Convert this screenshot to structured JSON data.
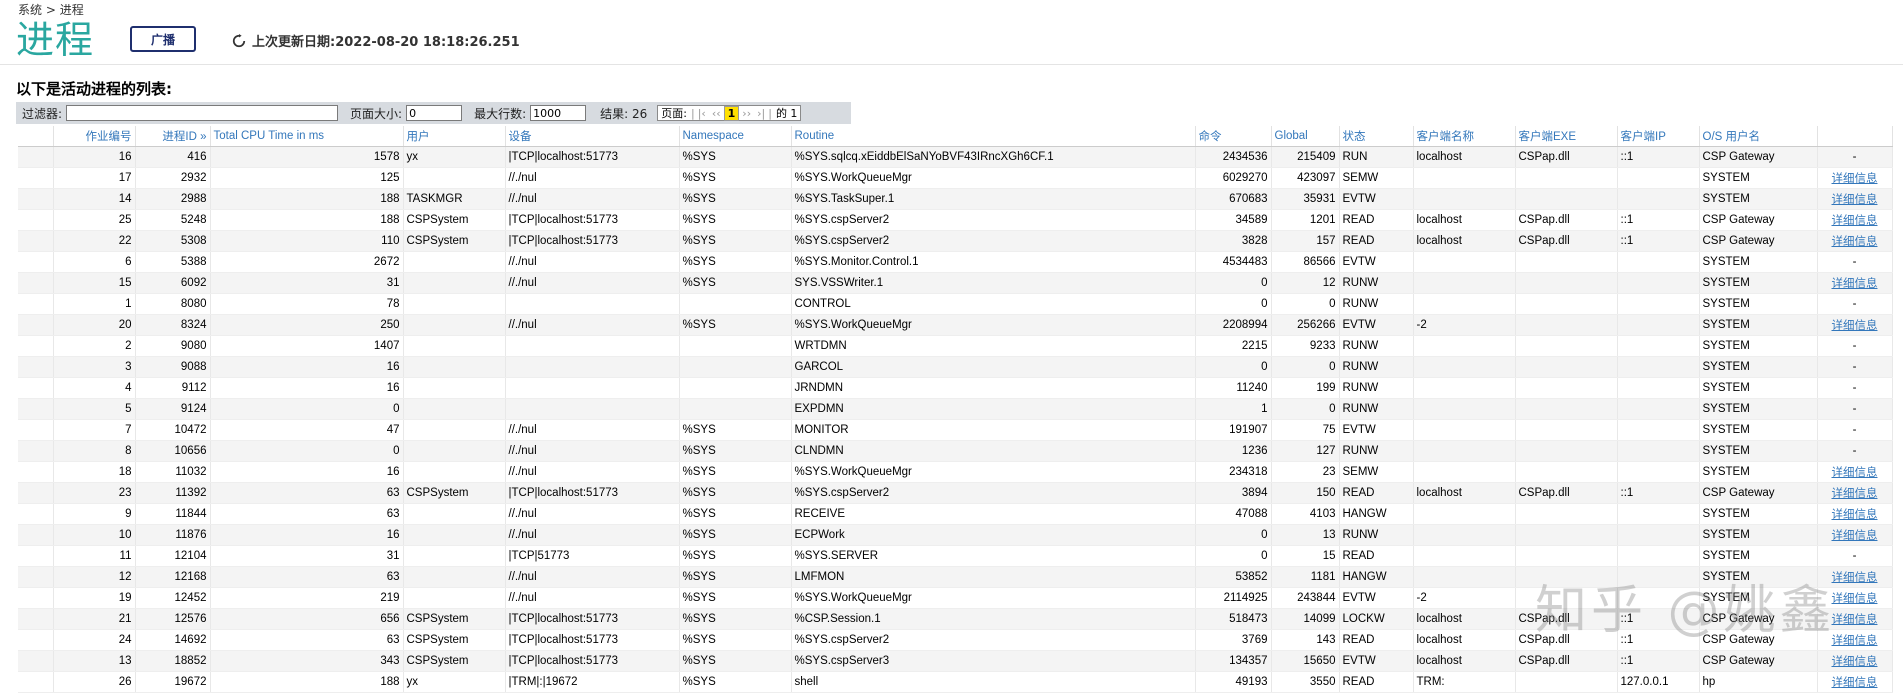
{
  "breadcrumb": {
    "root": "系统",
    "sep": ">",
    "current": "进程"
  },
  "title": "进程",
  "broadcast_label": "广播",
  "last_update": "上次更新日期:2022-08-20 18:18:26.251",
  "list_title": "以下是活动进程的列表:",
  "filter": {
    "filter_label": "过滤器:",
    "filter_value": "",
    "page_size_label": "页面大小:",
    "page_size_value": "0",
    "max_rows_label": "最大行数:",
    "max_rows_value": "1000",
    "results_label": "结果: 26",
    "page_label": "页面:",
    "first": "|‹",
    "prev": "‹‹",
    "current_page": "1",
    "next": "››",
    "last": "›|",
    "of_label": "的 1"
  },
  "columns": [
    "",
    "作业编号",
    "进程ID »",
    "Total CPU Time in ms",
    "用户",
    "设备",
    "Namespace",
    "Routine",
    "命令",
    "Global",
    "状态",
    "客户端名称",
    "客户端EXE",
    "客户端IP",
    "O/S 用户名",
    ""
  ],
  "rows": [
    [
      "16",
      "416",
      "1578",
      "yx",
      "|TCP|localhost:51773",
      "%SYS",
      "%SYS.sqlcq.xEiddbElSaNYoBVF43IRncXGh6CF.1",
      "2434536",
      "215409",
      "RUN",
      "localhost",
      "CSPap.dll",
      "::1",
      "CSP Gateway",
      "-"
    ],
    [
      "17",
      "2932",
      "125",
      "",
      "//./nul",
      "%SYS",
      "%SYS.WorkQueueMgr",
      "6029270",
      "423097",
      "SEMW",
      "",
      "",
      "",
      "SYSTEM",
      "详细信息"
    ],
    [
      "14",
      "2988",
      "188",
      "TASKMGR",
      "//./nul",
      "%SYS",
      "%SYS.TaskSuper.1",
      "670683",
      "35931",
      "EVTW",
      "",
      "",
      "",
      "SYSTEM",
      "详细信息"
    ],
    [
      "25",
      "5248",
      "188",
      "CSPSystem",
      "|TCP|localhost:51773",
      "%SYS",
      "%SYS.cspServer2",
      "34589",
      "1201",
      "READ",
      "localhost",
      "CSPap.dll",
      "::1",
      "CSP Gateway",
      "详细信息"
    ],
    [
      "22",
      "5308",
      "110",
      "CSPSystem",
      "|TCP|localhost:51773",
      "%SYS",
      "%SYS.cspServer2",
      "3828",
      "157",
      "READ",
      "localhost",
      "CSPap.dll",
      "::1",
      "CSP Gateway",
      "详细信息"
    ],
    [
      "6",
      "5388",
      "2672",
      "",
      "//./nul",
      "%SYS",
      "%SYS.Monitor.Control.1",
      "4534483",
      "86566",
      "EVTW",
      "",
      "",
      "",
      "SYSTEM",
      "-"
    ],
    [
      "15",
      "6092",
      "31",
      "",
      "//./nul",
      "%SYS",
      "SYS.VSSWriter.1",
      "0",
      "12",
      "RUNW",
      "",
      "",
      "",
      "SYSTEM",
      "详细信息"
    ],
    [
      "1",
      "8080",
      "78",
      "",
      "",
      "",
      "CONTROL",
      "0",
      "0",
      "RUNW",
      "",
      "",
      "",
      "SYSTEM",
      "-"
    ],
    [
      "20",
      "8324",
      "250",
      "",
      "//./nul",
      "%SYS",
      "%SYS.WorkQueueMgr",
      "2208994",
      "256266",
      "EVTW",
      "-2",
      "",
      "",
      "SYSTEM",
      "详细信息"
    ],
    [
      "2",
      "9080",
      "1407",
      "",
      "",
      "",
      "WRTDMN",
      "2215",
      "9233",
      "RUNW",
      "",
      "",
      "",
      "SYSTEM",
      "-"
    ],
    [
      "3",
      "9088",
      "16",
      "",
      "",
      "",
      "GARCOL",
      "0",
      "0",
      "RUNW",
      "",
      "",
      "",
      "SYSTEM",
      "-"
    ],
    [
      "4",
      "9112",
      "16",
      "",
      "",
      "",
      "JRNDMN",
      "11240",
      "199",
      "RUNW",
      "",
      "",
      "",
      "SYSTEM",
      "-"
    ],
    [
      "5",
      "9124",
      "0",
      "",
      "",
      "",
      "EXPDMN",
      "1",
      "0",
      "RUNW",
      "",
      "",
      "",
      "SYSTEM",
      "-"
    ],
    [
      "7",
      "10472",
      "47",
      "",
      "//./nul",
      "%SYS",
      "MONITOR",
      "191907",
      "75",
      "EVTW",
      "",
      "",
      "",
      "SYSTEM",
      "-"
    ],
    [
      "8",
      "10656",
      "0",
      "",
      "//./nul",
      "%SYS",
      "CLNDMN",
      "1236",
      "127",
      "RUNW",
      "",
      "",
      "",
      "SYSTEM",
      "-"
    ],
    [
      "18",
      "11032",
      "16",
      "",
      "//./nul",
      "%SYS",
      "%SYS.WorkQueueMgr",
      "234318",
      "23",
      "SEMW",
      "",
      "",
      "",
      "SYSTEM",
      "详细信息"
    ],
    [
      "23",
      "11392",
      "63",
      "CSPSystem",
      "|TCP|localhost:51773",
      "%SYS",
      "%SYS.cspServer2",
      "3894",
      "150",
      "READ",
      "localhost",
      "CSPap.dll",
      "::1",
      "CSP Gateway",
      "详细信息"
    ],
    [
      "9",
      "11844",
      "63",
      "",
      "//./nul",
      "%SYS",
      "RECEIVE",
      "47088",
      "4103",
      "HANGW",
      "",
      "",
      "",
      "SYSTEM",
      "详细信息"
    ],
    [
      "10",
      "11876",
      "16",
      "",
      "//./nul",
      "%SYS",
      "ECPWork",
      "0",
      "13",
      "RUNW",
      "",
      "",
      "",
      "SYSTEM",
      "详细信息"
    ],
    [
      "11",
      "12104",
      "31",
      "",
      "|TCP|51773",
      "%SYS",
      "%SYS.SERVER",
      "0",
      "15",
      "READ",
      "",
      "",
      "",
      "SYSTEM",
      "-"
    ],
    [
      "12",
      "12168",
      "63",
      "",
      "//./nul",
      "%SYS",
      "LMFMON",
      "53852",
      "1181",
      "HANGW",
      "",
      "",
      "",
      "SYSTEM",
      "详细信息"
    ],
    [
      "19",
      "12452",
      "219",
      "",
      "//./nul",
      "%SYS",
      "%SYS.WorkQueueMgr",
      "2114925",
      "243844",
      "EVTW",
      "-2",
      "",
      "",
      "SYSTEM",
      "详细信息"
    ],
    [
      "21",
      "12576",
      "656",
      "CSPSystem",
      "|TCP|localhost:51773",
      "%SYS",
      "%CSP.Session.1",
      "518473",
      "14099",
      "LOCKW",
      "localhost",
      "CSPap.dll",
      "::1",
      "CSP Gateway",
      "详细信息"
    ],
    [
      "24",
      "14692",
      "63",
      "CSPSystem",
      "|TCP|localhost:51773",
      "%SYS",
      "%SYS.cspServer2",
      "3769",
      "143",
      "READ",
      "localhost",
      "CSPap.dll",
      "::1",
      "CSP Gateway",
      "详细信息"
    ],
    [
      "13",
      "18852",
      "343",
      "CSPSystem",
      "|TCP|localhost:51773",
      "%SYS",
      "%SYS.cspServer3",
      "134357",
      "15650",
      "EVTW",
      "localhost",
      "CSPap.dll",
      "::1",
      "CSP Gateway",
      "详细信息"
    ],
    [
      "26",
      "19672",
      "188",
      "yx",
      "|TRM|:|19672",
      "%SYS",
      "shell",
      "49193",
      "3550",
      "READ",
      "TRM:",
      "",
      "127.0.0.1",
      "hp",
      "详细信息"
    ]
  ],
  "watermark": "知乎 @姚鑫"
}
